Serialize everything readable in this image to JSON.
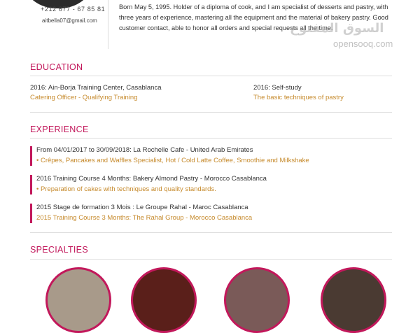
{
  "header": {
    "phone": "+212 677 - 67 85 81",
    "email": "aitbella07@gmail.com",
    "bio": "Born May 5, 1995. Holder of a diploma of cook, and I am specialist of desserts and pastry, with three years of experience, mastering all the equipment and the material of bakery pastry. Good customer contact, able to honor all orders and special requests all the time."
  },
  "watermark": {
    "arabic": "السوق المفتوح",
    "latin": "opensooq.com"
  },
  "education": {
    "title": "EDUCATION",
    "items": [
      {
        "head": "2016: Ain-Borja Training Center, Casablanca",
        "sub": "Catering Officer - Qualifying Training"
      },
      {
        "head": "2016: Self-study",
        "sub": "The basic techniques of pastry"
      }
    ]
  },
  "experience": {
    "title": "EXPERIENCE",
    "items": [
      {
        "head": "From 04/01/2017 to 30/09/2018: La Rochelle Cafe - United Arab Emirates",
        "sub": "• Crêpes, Pancakes and Waffles Specialist, Hot / Cold Latte Coffee, Smoothie and Milkshake"
      },
      {
        "head": "2016 Training Course 4 Months: Bakery Almond Pastry - Morocco Casablanca",
        "sub": "• Preparation of cakes with techniques and quality standards."
      },
      {
        "head": "2015 Stage de formation 3 Mois : Le Groupe Rahal - Maroc Casablanca",
        "sub": "2015 Training Course 3 Months: The Rahal Group - Morocco Casablanca"
      }
    ]
  },
  "specialties": {
    "title": "SPECIALTIES"
  },
  "colors": {
    "accent": "#c2185b",
    "gold": "#c68a2c"
  }
}
